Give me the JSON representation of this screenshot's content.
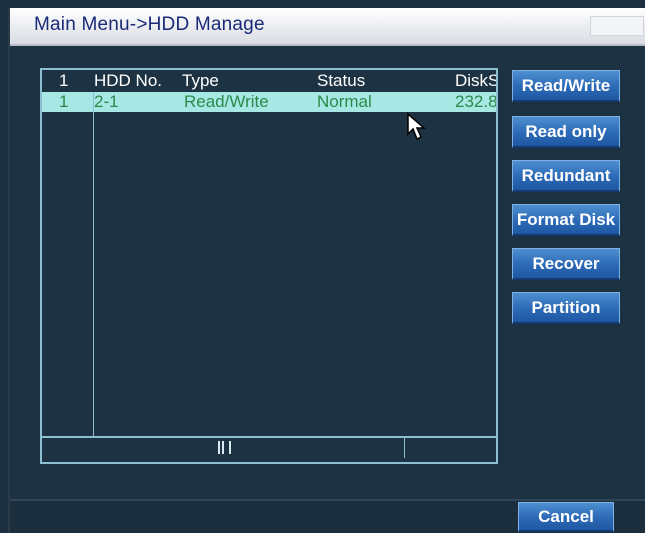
{
  "window": {
    "title": "Main Menu->HDD Manage"
  },
  "table": {
    "headers": {
      "index": "1",
      "hdd_no": "HDD No.",
      "type": "Type",
      "status": "Status",
      "disk": "DiskS"
    },
    "rows": [
      {
        "index": "1",
        "hdd_no": "2-1",
        "type": "Read/Write",
        "status": "Normal",
        "disk": "232.8"
      }
    ]
  },
  "buttons": {
    "read_write": "Read/Write",
    "read_only": "Read only",
    "redundant": "Redundant",
    "format_disk": "Format Disk",
    "recover": "Recover",
    "partition": "Partition",
    "cancel": "Cancel"
  }
}
